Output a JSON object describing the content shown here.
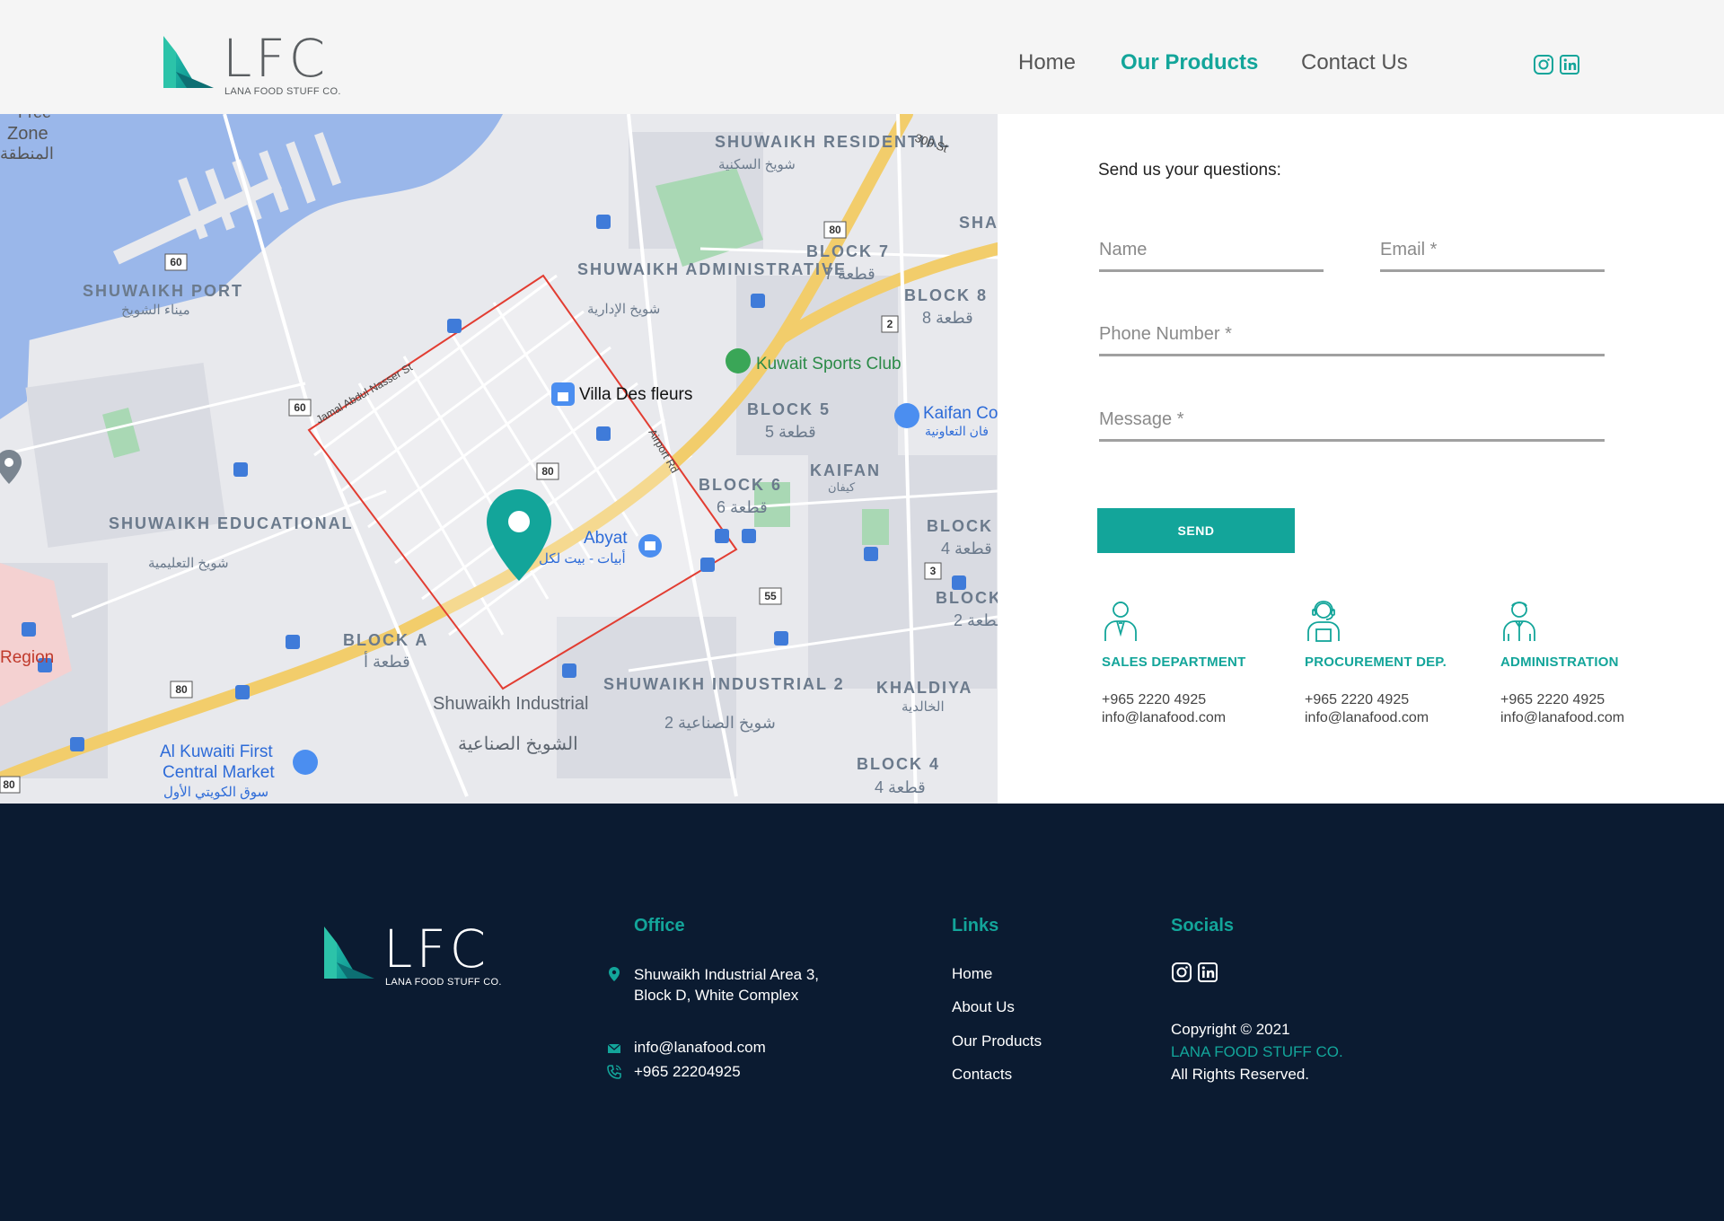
{
  "brand": {
    "letters": "LFC",
    "subtitle": "LANA FOOD STUFF CO."
  },
  "colors": {
    "accent": "#13a59a",
    "footer_bg": "#0b1b31",
    "header_bg": "#f5f5f5"
  },
  "nav": {
    "items": [
      "Home",
      "Our Products",
      "Contact Us"
    ],
    "active": "Our Products"
  },
  "header_socials": [
    "instagram-icon",
    "linkedin-icon"
  ],
  "map": {
    "labels": {
      "shuwaikh_port": "SHUWAIKH PORT",
      "shuwaikh_port_ar": "ميناء الشويخ",
      "shuwaikh_residential": "SHUWAIKH RESIDENTIAL",
      "shuwaikh_residential_ar": "شويخ السكنية",
      "shuwaikh_administrative": "SHUWAIKH ADMINISTRATIVE",
      "shuwaikh_administrative_ar": "شويخ الإدارية",
      "shuwaikh_educational": "SHUWAIKH EDUCATIONAL",
      "shuwaikh_educational_ar": "شويخ التعليمية",
      "shuwaikh_industrial": "Shuwaikh Industrial",
      "shuwaikh_industrial_ar": "الشويخ الصناعية",
      "shuwaikh_industrial_2": "SHUWAIKH INDUSTRIAL 2",
      "shuwaikh_industrial_2_ar": "شويخ الصناعية 2",
      "block_7": "BLOCK 7",
      "block_7_ar": "قطعة 7",
      "block_8": "BLOCK 8",
      "block_8_ar": "قطعة 8",
      "block_5": "BLOCK 5",
      "block_5_ar": "قطعة 5",
      "block_6": "BLOCK 6",
      "block_6_ar": "قطعة 6",
      "block_a": "BLOCK A",
      "block_a_ar": "قطعة أ",
      "block_4": "BLOCK 4",
      "block_4_ar": "قطعة 4",
      "block_2": "BLOCK 2",
      "block_2_ar": "قطعة 2",
      "block_4_right": "BLOCK 4",
      "block_4_right_ar": "قطعة 4",
      "block_sha": "SHA",
      "kaifan": "KAIFAN",
      "kaifan_ar": "كيفان",
      "khaldiya": "KHALDIYA",
      "khaldiya_ar": "الخالدية",
      "zone": "Zone",
      "free_zone": "Free",
      "zone_ar": "المنطقة",
      "region": "Region",
      "villa_des_fleurs": "Villa Des fleurs",
      "abyat": "Abyat",
      "abyat_ar": "أبيات - بيت لكل",
      "kuwait_sports_club": "Kuwait Sports Club",
      "kaifan_coop": "Kaifan Co",
      "kaifan_coop_ar": "فان التعاونية",
      "al_kuwaiti_first": "Al Kuwaiti First",
      "central_market": "Central Market",
      "central_market_ar": "سوق الكويتي الأول",
      "jamal_abdul_nasser": "Jamal Abdul Nasser St",
      "airport_rd": "Airport Rd",
      "st_300": "300 St"
    },
    "road_shields": [
      "60",
      "60",
      "80",
      "80",
      "80",
      "80",
      "2",
      "3",
      "55"
    ]
  },
  "form": {
    "title": "Send us your questions:",
    "name_placeholder": "Name",
    "email_placeholder": "Email *",
    "phone_placeholder": "Phone Number *",
    "message_placeholder": "Message *",
    "send_label": "SEND"
  },
  "departments": [
    {
      "title": "SALES DEPARTMENT",
      "phone": "+965  2220 4925",
      "email": "info@lanafood.com",
      "icon": "salesperson-icon"
    },
    {
      "title": "PROCUREMENT DEP.",
      "phone": "+965  2220 4925",
      "email": "info@lanafood.com",
      "icon": "headset-agent-icon"
    },
    {
      "title": "ADMINISTRATION",
      "phone": "+965  2220 4925",
      "email": "info@lanafood.com",
      "icon": "administrator-icon"
    }
  ],
  "footer": {
    "office": {
      "heading": "Office",
      "address_line1": "Shuwaikh Industrial Area 3,",
      "address_line2": "Block D, White Complex",
      "email": "info@lanafood.com",
      "phone": "+965 22204925"
    },
    "links": {
      "heading": "Links",
      "items": [
        "Home",
        "About Us",
        "Our Products",
        "Contacts"
      ]
    },
    "socials": {
      "heading": "Socials",
      "icons": [
        "instagram-icon",
        "linkedin-icon"
      ],
      "copyright": "Copyright © 2021",
      "company": "LANA FOOD STUFF CO.",
      "rights": "All Rights Reserved."
    }
  }
}
